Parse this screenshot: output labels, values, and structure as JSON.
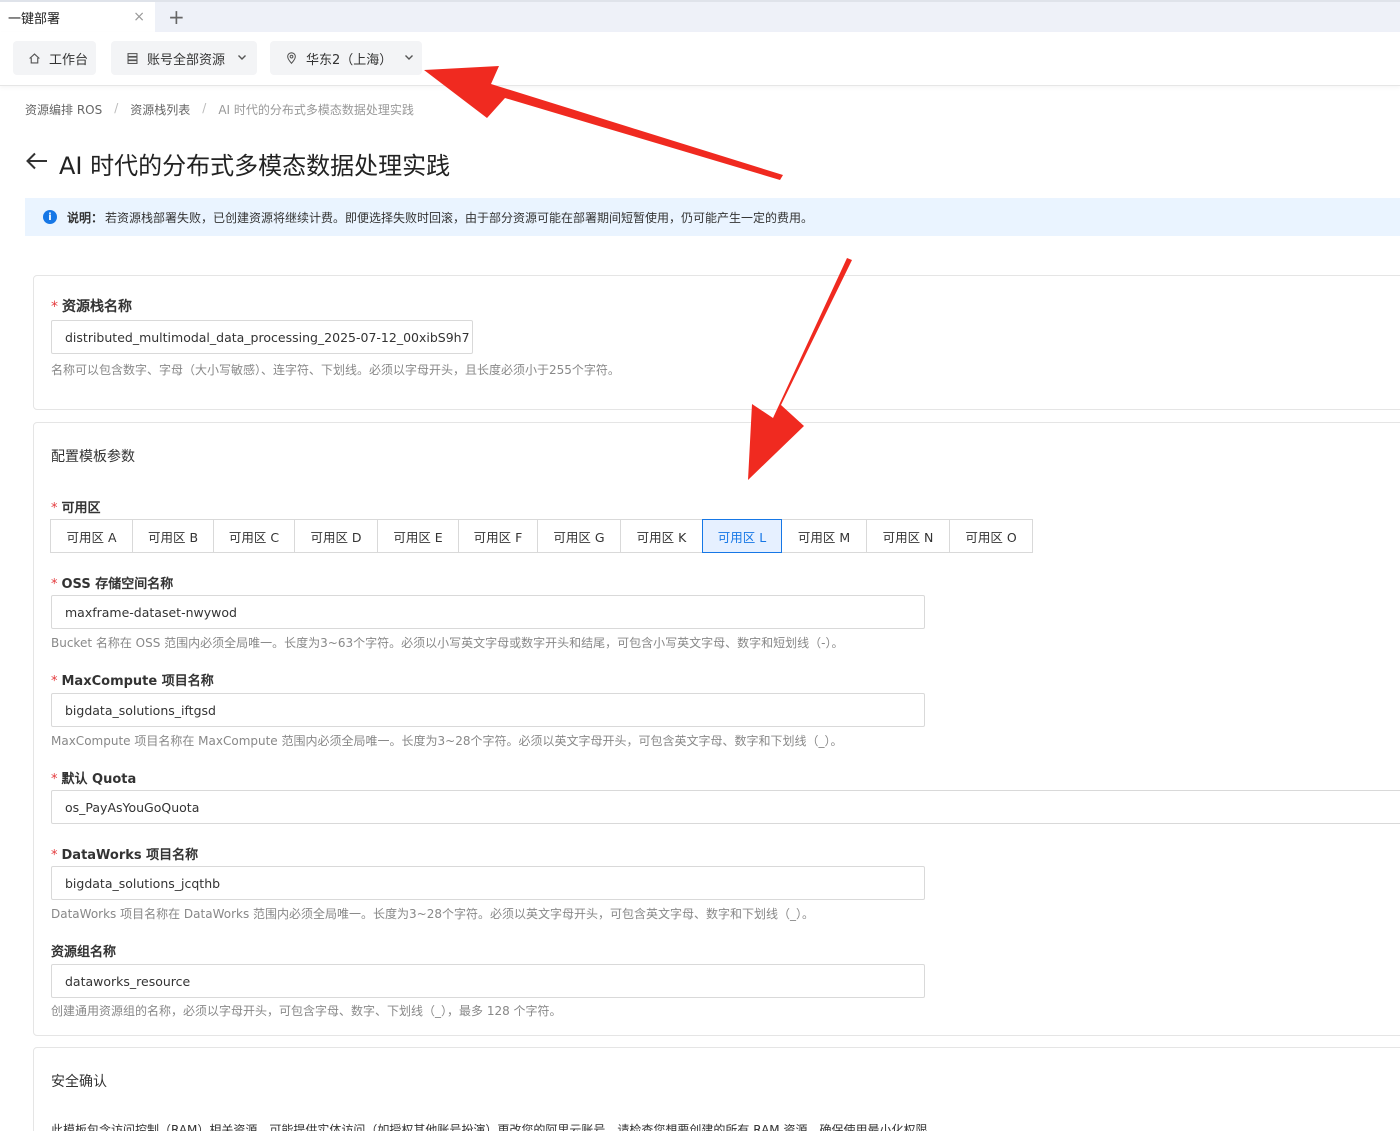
{
  "tab": {
    "title": "一键部署",
    "close": "×",
    "add": "+"
  },
  "toolbar": {
    "workbench": "工作台",
    "resources": "账号全部资源",
    "region": "华东2（上海）"
  },
  "breadcrumb": {
    "items": [
      "资源编排 ROS",
      "资源栈列表"
    ],
    "current": "AI 时代的分布式多模态数据处理实践",
    "separator": "/"
  },
  "page": {
    "title": "AI 时代的分布式多模态数据处理实践"
  },
  "notice": {
    "label": "说明：",
    "text": "若资源栈部署失败，已创建资源将继续计费。即便选择失败时回滚，由于部分资源可能在部署期间短暂使用，仍可能产生一定的费用。"
  },
  "stack_name": {
    "label": "资源栈名称",
    "value": "distributed_multimodal_data_processing_2025-07-12_00xibS9h7",
    "help": "名称可以包含数字、字母（大小写敏感）、连字符、下划线。必须以字母开头，且长度必须小于255个字符。"
  },
  "config": {
    "title": "配置模板参数",
    "zone_label": "可用区",
    "zones": [
      "可用区 A",
      "可用区 B",
      "可用区 C",
      "可用区 D",
      "可用区 E",
      "可用区 F",
      "可用区 G",
      "可用区 K",
      "可用区 L",
      "可用区 M",
      "可用区 N",
      "可用区 O"
    ],
    "selected_zone": "可用区 L",
    "oss": {
      "label": "OSS 存储空间名称",
      "value": "maxframe-dataset-nwywod",
      "help": "Bucket 名称在 OSS 范围内必须全局唯一。长度为3~63个字符。必须以小写英文字母或数字开头和结尾，可包含小写英文字母、数字和短划线（-）。"
    },
    "maxcompute": {
      "label": "MaxCompute 项目名称",
      "value": "bigdata_solutions_iftgsd",
      "help": "MaxCompute 项目名称在 MaxCompute 范围内必须全局唯一。长度为3~28个字符。必须以英文字母开头，可包含英文字母、数字和下划线（_）。"
    },
    "quota": {
      "label": "默认 Quota",
      "value": "os_PayAsYouGoQuota"
    },
    "dataworks": {
      "label": "DataWorks 项目名称",
      "value": "bigdata_solutions_jcqthb",
      "help": "DataWorks 项目名称在 DataWorks 范围内必须全局唯一。长度为3~28个字符。必须以英文字母开头，可包含英文字母、数字和下划线（_）。"
    },
    "resource_group": {
      "label": "资源组名称",
      "value": "dataworks_resource",
      "help": "创建通用资源组的名称，必须以字母开头，可包含字母、数字、下划线（_），最多 128 个字符。"
    }
  },
  "security": {
    "title": "安全确认",
    "text": "此模板包含访问控制（RAM）相关资源，可能提供实体访问（如授权其他账号扮演）更改您的阿里云账号。请检查您想要创建的所有 RAM 资源，确保使用最小化权限。"
  },
  "colors": {
    "accent": "#1677e6",
    "annotation_arrow": "#f02a20",
    "notice_bg": "#eaf4ff"
  }
}
